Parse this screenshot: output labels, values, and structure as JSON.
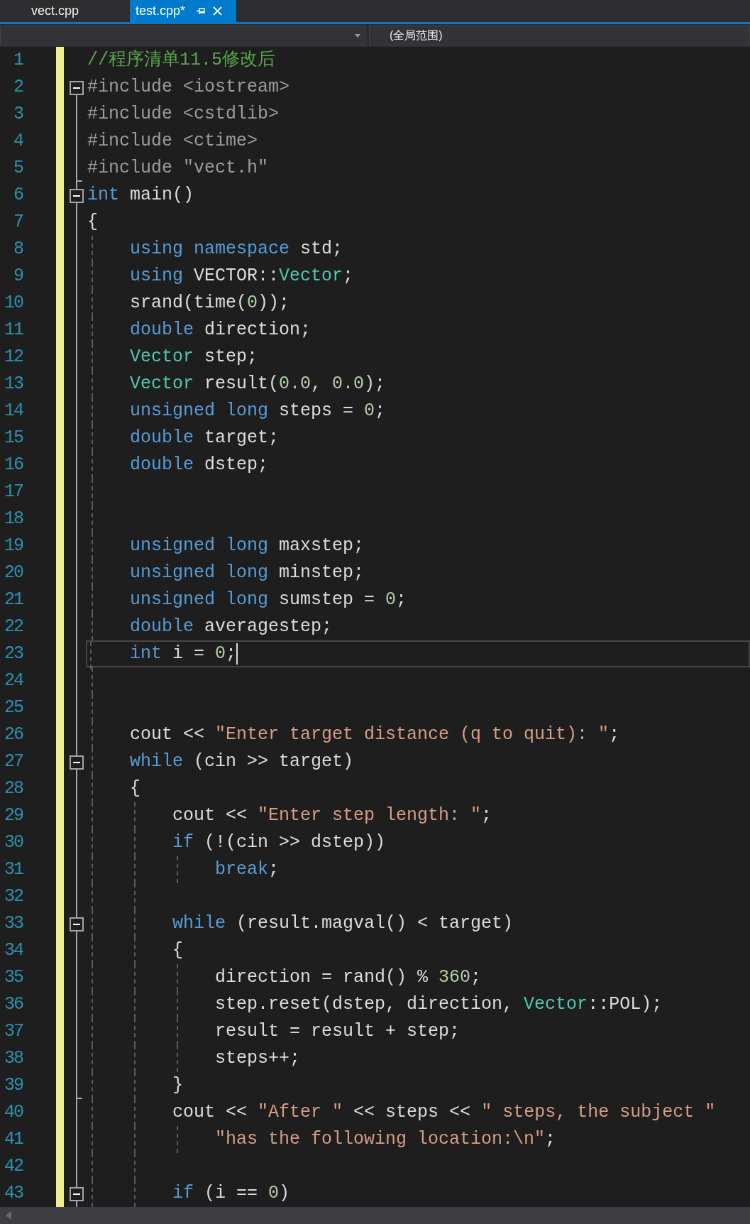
{
  "tabs": [
    {
      "label": "vect.cpp",
      "selected": false
    },
    {
      "label": "test.cpp*",
      "selected": true
    }
  ],
  "navigation_bar": {
    "scope_dropdown": "(全局范围)"
  },
  "lines": [
    {
      "number": "1",
      "modified": true,
      "tokens": [
        {
          "kind": "comment",
          "text": "//程序清单11.5修改后"
        }
      ]
    },
    {
      "number": "2",
      "modified": true,
      "fold_start": true,
      "tokens": [
        {
          "kind": "preprocessor",
          "text": "#include <iostream>"
        }
      ]
    },
    {
      "number": "3",
      "modified": true,
      "tokens": [
        {
          "kind": "preprocessor",
          "text": "#include <cstdlib>"
        }
      ]
    },
    {
      "number": "4",
      "modified": true,
      "tokens": [
        {
          "kind": "preprocessor",
          "text": "#include <ctime>"
        }
      ]
    },
    {
      "number": "5",
      "modified": true,
      "fold_end": true,
      "tokens": [
        {
          "kind": "preprocessor",
          "text": "#include \"vect.h\""
        }
      ]
    },
    {
      "number": "6",
      "modified": true,
      "fold_start": true,
      "tokens": [
        {
          "kind": "keyword",
          "text": "int"
        },
        {
          "kind": "plain",
          "text": " main()"
        }
      ]
    },
    {
      "number": "7",
      "modified": true,
      "tokens": [
        {
          "kind": "plain",
          "text": "{"
        }
      ]
    },
    {
      "number": "8",
      "modified": true,
      "tokens": [
        {
          "kind": "keyword",
          "text": "    using"
        },
        {
          "kind": "keyword",
          "text": " namespace"
        },
        {
          "kind": "plain",
          "text": " std;"
        }
      ]
    },
    {
      "number": "9",
      "modified": true,
      "tokens": [
        {
          "kind": "keyword",
          "text": "    using"
        },
        {
          "kind": "plain",
          "text": " VECTOR::"
        },
        {
          "kind": "type",
          "text": "Vector"
        },
        {
          "kind": "plain",
          "text": ";"
        }
      ]
    },
    {
      "number": "10",
      "modified": true,
      "tokens": [
        {
          "kind": "plain",
          "text": "    srand(time("
        },
        {
          "kind": "number",
          "text": "0"
        },
        {
          "kind": "plain",
          "text": "));"
        }
      ]
    },
    {
      "number": "11",
      "modified": true,
      "tokens": [
        {
          "kind": "keyword",
          "text": "    double"
        },
        {
          "kind": "plain",
          "text": " direction;"
        }
      ]
    },
    {
      "number": "12",
      "modified": true,
      "tokens": [
        {
          "kind": "type",
          "text": "    Vector"
        },
        {
          "kind": "plain",
          "text": " step;"
        }
      ]
    },
    {
      "number": "13",
      "modified": true,
      "tokens": [
        {
          "kind": "type",
          "text": "    Vector"
        },
        {
          "kind": "plain",
          "text": " result("
        },
        {
          "kind": "number",
          "text": "0.0"
        },
        {
          "kind": "plain",
          "text": ","
        },
        {
          "kind": "number",
          "text": " 0.0"
        },
        {
          "kind": "plain",
          "text": ");"
        }
      ]
    },
    {
      "number": "14",
      "modified": true,
      "tokens": [
        {
          "kind": "keyword",
          "text": "    unsigned"
        },
        {
          "kind": "keyword",
          "text": " long"
        },
        {
          "kind": "plain",
          "text": " steps = "
        },
        {
          "kind": "number",
          "text": "0"
        },
        {
          "kind": "plain",
          "text": ";"
        }
      ]
    },
    {
      "number": "15",
      "modified": true,
      "tokens": [
        {
          "kind": "keyword",
          "text": "    double"
        },
        {
          "kind": "plain",
          "text": " target;"
        }
      ]
    },
    {
      "number": "16",
      "modified": true,
      "tokens": [
        {
          "kind": "keyword",
          "text": "    double"
        },
        {
          "kind": "plain",
          "text": " dstep;"
        }
      ]
    },
    {
      "number": "17",
      "modified": true
    },
    {
      "number": "18",
      "modified": true
    },
    {
      "number": "19",
      "modified": true,
      "tokens": [
        {
          "kind": "keyword",
          "text": "    unsigned"
        },
        {
          "kind": "keyword",
          "text": " long"
        },
        {
          "kind": "plain",
          "text": " maxstep;"
        }
      ]
    },
    {
      "number": "20",
      "modified": true,
      "tokens": [
        {
          "kind": "keyword",
          "text": "    unsigned"
        },
        {
          "kind": "keyword",
          "text": " long"
        },
        {
          "kind": "plain",
          "text": " minstep;"
        }
      ]
    },
    {
      "number": "21",
      "modified": true,
      "tokens": [
        {
          "kind": "keyword",
          "text": "    unsigned"
        },
        {
          "kind": "keyword",
          "text": " long"
        },
        {
          "kind": "plain",
          "text": " sumstep = "
        },
        {
          "kind": "number",
          "text": "0"
        },
        {
          "kind": "plain",
          "text": ";"
        }
      ]
    },
    {
      "number": "22",
      "modified": true,
      "tokens": [
        {
          "kind": "keyword",
          "text": "    double"
        },
        {
          "kind": "plain",
          "text": " averagestep;"
        }
      ]
    },
    {
      "number": "23",
      "modified": true,
      "current": true,
      "tokens": [
        {
          "kind": "keyword",
          "text": "    int"
        },
        {
          "kind": "plain",
          "text": " i = "
        },
        {
          "kind": "number",
          "text": "0"
        },
        {
          "kind": "plain",
          "text": ";"
        }
      ]
    },
    {
      "number": "24",
      "modified": true
    },
    {
      "number": "25",
      "modified": true
    },
    {
      "number": "26",
      "modified": true,
      "tokens": [
        {
          "kind": "plain",
          "text": "    cout << "
        },
        {
          "kind": "string",
          "text": "\"Enter target distance (q to quit): \""
        },
        {
          "kind": "plain",
          "text": ";"
        }
      ]
    },
    {
      "number": "27",
      "modified": true,
      "fold_start": true,
      "tokens": [
        {
          "kind": "keyword",
          "text": "    while"
        },
        {
          "kind": "plain",
          "text": " (cin >> target)"
        }
      ]
    },
    {
      "number": "28",
      "modified": true,
      "tokens": [
        {
          "kind": "plain",
          "text": "    {"
        }
      ]
    },
    {
      "number": "29",
      "modified": true,
      "tokens": [
        {
          "kind": "plain",
          "text": "        cout << "
        },
        {
          "kind": "string",
          "text": "\"Enter step length: \""
        },
        {
          "kind": "plain",
          "text": ";"
        }
      ]
    },
    {
      "number": "30",
      "modified": true,
      "tokens": [
        {
          "kind": "keyword",
          "text": "        if"
        },
        {
          "kind": "plain",
          "text": " (!(cin >> dstep))"
        }
      ]
    },
    {
      "number": "31",
      "modified": true,
      "tokens": [
        {
          "kind": "keyword",
          "text": "            break"
        },
        {
          "kind": "plain",
          "text": ";"
        }
      ]
    },
    {
      "number": "32",
      "modified": true
    },
    {
      "number": "33",
      "modified": true,
      "fold_start": true,
      "tokens": [
        {
          "kind": "keyword",
          "text": "        while"
        },
        {
          "kind": "plain",
          "text": " (result.magval() < target)"
        }
      ]
    },
    {
      "number": "34",
      "modified": true,
      "tokens": [
        {
          "kind": "plain",
          "text": "        {"
        }
      ]
    },
    {
      "number": "35",
      "modified": true,
      "tokens": [
        {
          "kind": "plain",
          "text": "            direction = rand() % "
        },
        {
          "kind": "number",
          "text": "360"
        },
        {
          "kind": "plain",
          "text": ";"
        }
      ]
    },
    {
      "number": "36",
      "modified": true,
      "tokens": [
        {
          "kind": "plain",
          "text": "            step.reset(dstep, direction, "
        },
        {
          "kind": "type",
          "text": "Vector"
        },
        {
          "kind": "plain",
          "text": "::POL);"
        }
      ]
    },
    {
      "number": "37",
      "modified": true,
      "tokens": [
        {
          "kind": "plain",
          "text": "            result = result + step;"
        }
      ]
    },
    {
      "number": "38",
      "modified": true,
      "tokens": [
        {
          "kind": "plain",
          "text": "            steps++;"
        }
      ]
    },
    {
      "number": "39",
      "modified": true,
      "fold_end": true,
      "tokens": [
        {
          "kind": "plain",
          "text": "        }"
        }
      ]
    },
    {
      "number": "40",
      "modified": true,
      "tokens": [
        {
          "kind": "plain",
          "text": "        cout << "
        },
        {
          "kind": "string",
          "text": "\"After \""
        },
        {
          "kind": "plain",
          "text": " << steps << "
        },
        {
          "kind": "string",
          "text": "\" steps, the subject \""
        }
      ]
    },
    {
      "number": "41",
      "modified": true,
      "tokens": [
        {
          "kind": "string",
          "text": "            \"has the following location:\\n\""
        },
        {
          "kind": "plain",
          "text": ";"
        }
      ]
    },
    {
      "number": "42",
      "modified": true
    },
    {
      "number": "43",
      "modified": true,
      "fold_start": true,
      "tokens": [
        {
          "kind": "keyword",
          "text": "        if"
        },
        {
          "kind": "plain",
          "text": " (i == "
        },
        {
          "kind": "number",
          "text": "0"
        },
        {
          "kind": "plain",
          "text": ")"
        }
      ]
    }
  ]
}
